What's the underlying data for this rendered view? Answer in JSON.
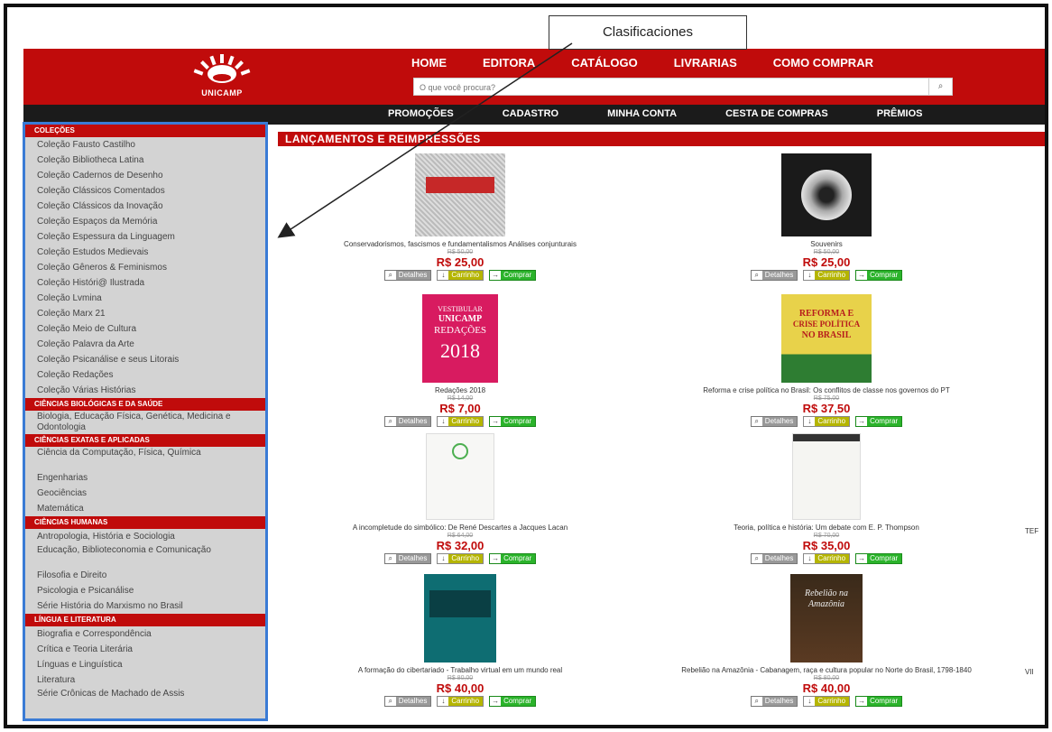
{
  "callout": {
    "label": "Clasificaciones"
  },
  "header": {
    "logo_text": "UNICAMP",
    "nav": [
      "HOME",
      "EDITORA",
      "CATÁLOGO",
      "LIVRARIAS",
      "COMO COMPRAR"
    ],
    "search_placeholder": "O que você procura?",
    "search_icon": "search-icon",
    "secondary_nav": [
      "PROMOÇÕES",
      "CADASTRO",
      "MINHA CONTA",
      "CESTA DE COMPRAS",
      "PRÊMIOS"
    ]
  },
  "sidebar": {
    "sections": [
      {
        "title": "COLEÇÕES",
        "items": [
          "Coleção Fausto Castilho",
          "Coleção Bibliotheca Latina",
          "Coleção Cadernos de Desenho",
          "Coleção Clássicos Comentados",
          "Coleção Clássicos da Inovação",
          "Coleção Espaços da Memória",
          "Coleção Espessura da Linguagem",
          "Coleção Estudos Medievais",
          "Coleção Gêneros & Feminismos",
          "Coleção Históri@ Ilustrada",
          "Coleção Lvmina",
          "Coleção Marx 21",
          "Coleção Meio de Cultura",
          "Coleção Palavra da Arte",
          "Coleção Psicanálise e seus Litorais",
          "Coleção Redações",
          "Coleção Várias Histórias"
        ]
      },
      {
        "title": "CIÊNCIAS BIOLÓGICAS E DA SAÚDE",
        "items": [
          "Biologia, Educação Física, Genética, Medicina e Odontologia"
        ]
      },
      {
        "title": "CIÊNCIAS EXATAS E APLICADAS",
        "items": [
          "Ciência da Computação, Física, Química",
          "Engenharias",
          "Geociências",
          "Matemática"
        ]
      },
      {
        "title": "CIÊNCIAS HUMANAS",
        "items": [
          "Antropologia, História e Sociologia",
          "Educação, Biblioteconomia e Comunicação",
          "Filosofia e Direito",
          "Psicologia e Psicanálise",
          "Série História do Marxismo no Brasil"
        ]
      },
      {
        "title": "LÍNGUA E LITERATURA",
        "items": [
          "Biografia e Correspondência",
          "Crítica e Teoria Literária",
          "Línguas e Linguística",
          "Literatura",
          "Série Crônicas de Machado de Assis"
        ]
      }
    ]
  },
  "main": {
    "section_title": "LANÇAMENTOS E REIMPRESSÕES",
    "buttons": {
      "details": "Detalhes",
      "cart": "Carrinho",
      "buy": "Comprar"
    },
    "products": [
      {
        "title": "Conservadorismos, fascismos e fundamentalismos Análises conjunturais",
        "old_price": "R$ 50,00",
        "price": "R$ 25,00"
      },
      {
        "title": "Souvenirs",
        "old_price": "R$ 50,00",
        "price": "R$ 25,00"
      },
      {
        "title": "Redações 2018",
        "old_price": "R$ 14,00",
        "price": "R$ 7,00",
        "cover_lines": [
          "VESTIBULAR",
          "UNICAMP",
          "REDAÇÕES",
          "2018"
        ]
      },
      {
        "title": "Reforma e crise política no Brasil: Os conflitos de classe nos governos do PT",
        "old_price": "R$ 75,00",
        "price": "R$ 37,50",
        "cover_lines": [
          "REFORMA E",
          "CRISE POLÍTICA",
          "NO BRASIL"
        ]
      },
      {
        "title": "A incompletude do simbólico: De René Descartes a Jacques Lacan",
        "old_price": "R$ 64,00",
        "price": "R$ 32,00"
      },
      {
        "title": "Teoria, política e história: Um debate com E. P. Thompson",
        "old_price": "R$ 70,00",
        "price": "R$ 35,00"
      },
      {
        "title": "A formação do cibertariado - Trabalho virtual em um mundo real",
        "old_price": "R$ 80,00",
        "price": "R$ 40,00"
      },
      {
        "title": "Rebelião na Amazônia - Cabanagem, raça e cultura popular no Norte do Brasil, 1798-1840",
        "old_price": "R$ 80,00",
        "price": "R$ 40,00",
        "cover_lines": [
          "Rebelião na",
          "Amazônia"
        ]
      }
    ],
    "edge_fragments": [
      "TEF",
      "VII"
    ]
  }
}
